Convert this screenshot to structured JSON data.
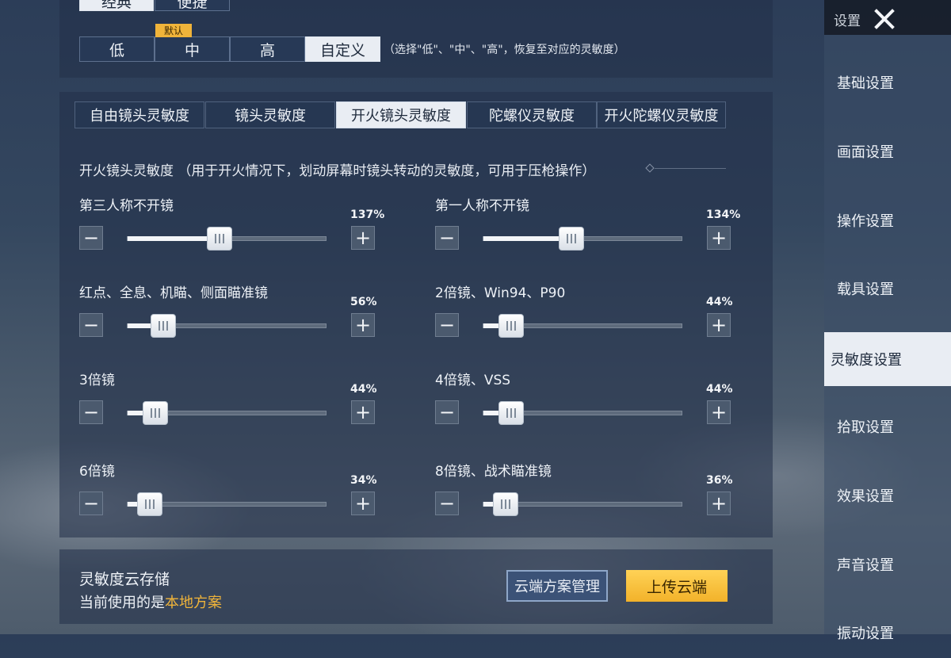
{
  "mode_tabs": [
    "经典",
    "便捷"
  ],
  "presets": {
    "default_tag": "默认",
    "options": [
      "低",
      "中",
      "高",
      "自定义"
    ],
    "selected_index": 3,
    "hint": "（选择\"低\"、\"中\"、\"高\"，恢复至对应的灵敏度）"
  },
  "sensitivity_tabs": {
    "items": [
      "自由镜头灵敏度",
      "镜头灵敏度",
      "开火镜头灵敏度",
      "陀螺仪灵敏度",
      "开火陀螺仪灵敏度"
    ],
    "selected_index": 2
  },
  "section_desc": "开火镜头灵敏度 （用于开火情况下，划动屏幕时镜头转动的灵敏度，可用于压枪操作）",
  "sliders": [
    {
      "label": "第三人称不开镜",
      "value_text": "137%",
      "fraction": 0.46
    },
    {
      "label": "第一人称不开镜",
      "value_text": "134%",
      "fraction": 0.44
    },
    {
      "label": "红点、全息、机瞄、侧面瞄准镜",
      "value_text": "56%",
      "fraction": 0.18
    },
    {
      "label": "2倍镜、Win94、P90",
      "value_text": "44%",
      "fraction": 0.14
    },
    {
      "label": "3倍镜",
      "value_text": "44%",
      "fraction": 0.14
    },
    {
      "label": "4倍镜、VSS",
      "value_text": "44%",
      "fraction": 0.14
    },
    {
      "label": "6倍镜",
      "value_text": "34%",
      "fraction": 0.11
    },
    {
      "label": "8倍镜、战术瞄准镜",
      "value_text": "36%",
      "fraction": 0.11
    }
  ],
  "cloud": {
    "title": "灵敏度云存储",
    "using_prefix": "当前使用的是",
    "using_value": "本地方案",
    "manage_label": "云端方案管理",
    "upload_label": "上传云端"
  },
  "sidebar": {
    "title": "设置",
    "items": [
      "基础设置",
      "画面设置",
      "操作设置",
      "载具设置",
      "灵敏度设置",
      "拾取设置",
      "效果设置",
      "声音设置",
      "振动设置"
    ],
    "selected_index": 4
  },
  "colors": {
    "accent": "#f0b43a",
    "selected": "#e9edf3"
  }
}
